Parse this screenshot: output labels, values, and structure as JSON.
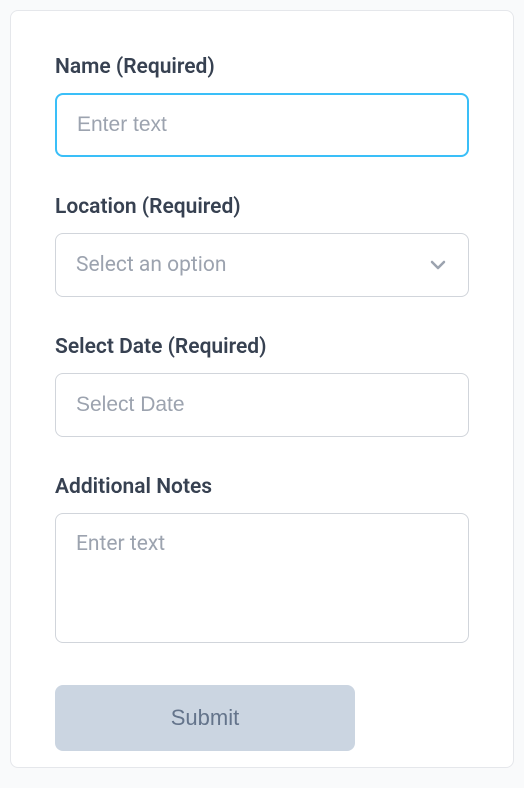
{
  "form": {
    "name": {
      "label": "Name (Required)",
      "placeholder": "Enter text",
      "value": ""
    },
    "location": {
      "label": "Location (Required)",
      "placeholder": "Select an option",
      "value": ""
    },
    "date": {
      "label": "Select Date (Required)",
      "placeholder": "Select Date",
      "value": ""
    },
    "notes": {
      "label": "Additional Notes",
      "placeholder": "Enter text",
      "value": ""
    },
    "submit_label": "Submit"
  }
}
